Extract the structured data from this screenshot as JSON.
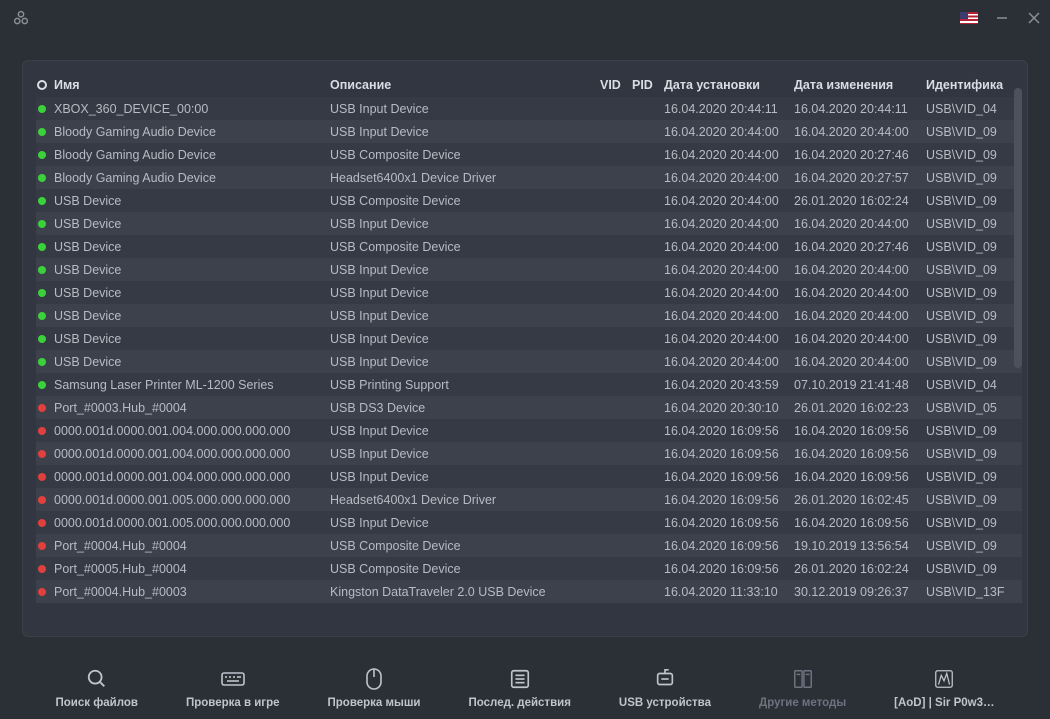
{
  "columns": {
    "name": "Имя",
    "desc": "Описание",
    "vid": "VID",
    "pid": "PID",
    "installed": "Дата установки",
    "modified": "Дата изменения",
    "id": "Идентифика"
  },
  "rows": [
    {
      "s": "green",
      "name": "XBOX_360_DEVICE_00:00",
      "desc": "USB Input Device",
      "vid": "",
      "pid": "",
      "inst": "16.04.2020 20:44:11",
      "mod": "16.04.2020 20:44:11",
      "id": "USB\\VID_04"
    },
    {
      "s": "green",
      "name": "Bloody Gaming Audio Device",
      "desc": "USB Input Device",
      "vid": "",
      "pid": "",
      "inst": "16.04.2020 20:44:00",
      "mod": "16.04.2020 20:44:00",
      "id": "USB\\VID_09"
    },
    {
      "s": "green",
      "name": "Bloody Gaming Audio Device",
      "desc": "USB Composite Device",
      "vid": "",
      "pid": "",
      "inst": "16.04.2020 20:44:00",
      "mod": "16.04.2020 20:27:46",
      "id": "USB\\VID_09"
    },
    {
      "s": "green",
      "name": "Bloody Gaming Audio Device",
      "desc": "Headset6400x1 Device Driver",
      "vid": "",
      "pid": "",
      "inst": "16.04.2020 20:44:00",
      "mod": "16.04.2020 20:27:57",
      "id": "USB\\VID_09"
    },
    {
      "s": "green",
      "name": "USB Device",
      "desc": "USB Composite Device",
      "vid": "",
      "pid": "",
      "inst": "16.04.2020 20:44:00",
      "mod": "26.01.2020 16:02:24",
      "id": "USB\\VID_09"
    },
    {
      "s": "green",
      "name": "USB Device",
      "desc": "USB Input Device",
      "vid": "",
      "pid": "",
      "inst": "16.04.2020 20:44:00",
      "mod": "16.04.2020 20:44:00",
      "id": "USB\\VID_09"
    },
    {
      "s": "green",
      "name": "USB Device",
      "desc": "USB Composite Device",
      "vid": "",
      "pid": "",
      "inst": "16.04.2020 20:44:00",
      "mod": "16.04.2020 20:27:46",
      "id": "USB\\VID_09"
    },
    {
      "s": "green",
      "name": "USB Device",
      "desc": "USB Input Device",
      "vid": "",
      "pid": "",
      "inst": "16.04.2020 20:44:00",
      "mod": "16.04.2020 20:44:00",
      "id": "USB\\VID_09"
    },
    {
      "s": "green",
      "name": "USB Device",
      "desc": "USB Input Device",
      "vid": "",
      "pid": "",
      "inst": "16.04.2020 20:44:00",
      "mod": "16.04.2020 20:44:00",
      "id": "USB\\VID_09"
    },
    {
      "s": "green",
      "name": "USB Device",
      "desc": "USB Input Device",
      "vid": "",
      "pid": "",
      "inst": "16.04.2020 20:44:00",
      "mod": "16.04.2020 20:44:00",
      "id": "USB\\VID_09"
    },
    {
      "s": "green",
      "name": "USB Device",
      "desc": "USB Input Device",
      "vid": "",
      "pid": "",
      "inst": "16.04.2020 20:44:00",
      "mod": "16.04.2020 20:44:00",
      "id": "USB\\VID_09"
    },
    {
      "s": "green",
      "name": "USB Device",
      "desc": "USB Input Device",
      "vid": "",
      "pid": "",
      "inst": "16.04.2020 20:44:00",
      "mod": "16.04.2020 20:44:00",
      "id": "USB\\VID_09"
    },
    {
      "s": "green",
      "name": "Samsung Laser Printer ML-1200 Series",
      "desc": "USB Printing Support",
      "vid": "",
      "pid": "",
      "inst": "16.04.2020 20:43:59",
      "mod": "07.10.2019 21:41:48",
      "id": "USB\\VID_04"
    },
    {
      "s": "red",
      "name": "Port_#0003.Hub_#0004",
      "desc": "USB DS3 Device",
      "vid": "",
      "pid": "",
      "inst": "16.04.2020 20:30:10",
      "mod": "26.01.2020 16:02:23",
      "id": "USB\\VID_05"
    },
    {
      "s": "red",
      "name": "0000.001d.0000.001.004.000.000.000.000",
      "desc": "USB Input Device",
      "vid": "",
      "pid": "",
      "inst": "16.04.2020 16:09:56",
      "mod": "16.04.2020 16:09:56",
      "id": "USB\\VID_09"
    },
    {
      "s": "red",
      "name": "0000.001d.0000.001.004.000.000.000.000",
      "desc": "USB Input Device",
      "vid": "",
      "pid": "",
      "inst": "16.04.2020 16:09:56",
      "mod": "16.04.2020 16:09:56",
      "id": "USB\\VID_09"
    },
    {
      "s": "red",
      "name": "0000.001d.0000.001.004.000.000.000.000",
      "desc": "USB Input Device",
      "vid": "",
      "pid": "",
      "inst": "16.04.2020 16:09:56",
      "mod": "16.04.2020 16:09:56",
      "id": "USB\\VID_09"
    },
    {
      "s": "red",
      "name": "0000.001d.0000.001.005.000.000.000.000",
      "desc": "Headset6400x1 Device Driver",
      "vid": "",
      "pid": "",
      "inst": "16.04.2020 16:09:56",
      "mod": "26.01.2020 16:02:45",
      "id": "USB\\VID_09"
    },
    {
      "s": "red",
      "name": "0000.001d.0000.001.005.000.000.000.000",
      "desc": "USB Input Device",
      "vid": "",
      "pid": "",
      "inst": "16.04.2020 16:09:56",
      "mod": "16.04.2020 16:09:56",
      "id": "USB\\VID_09"
    },
    {
      "s": "red",
      "name": "Port_#0004.Hub_#0004",
      "desc": "USB Composite Device",
      "vid": "",
      "pid": "",
      "inst": "16.04.2020 16:09:56",
      "mod": "19.10.2019 13:56:54",
      "id": "USB\\VID_09"
    },
    {
      "s": "red",
      "name": "Port_#0005.Hub_#0004",
      "desc": "USB Composite Device",
      "vid": "",
      "pid": "",
      "inst": "16.04.2020 16:09:56",
      "mod": "26.01.2020 16:02:24",
      "id": "USB\\VID_09"
    },
    {
      "s": "red",
      "name": "Port_#0004.Hub_#0003",
      "desc": "Kingston DataTraveler 2.0 USB Device",
      "vid": "",
      "pid": "",
      "inst": "16.04.2020 11:33:10",
      "mod": "30.12.2019 09:26:37",
      "id": "USB\\VID_13F"
    }
  ],
  "nav": {
    "search": "Поиск файлов",
    "ingame": "Проверка в игре",
    "mouse": "Проверка мыши",
    "recent": "Послед. действия",
    "usb": "USB устройства",
    "other": "Другие методы",
    "user": "[AoD] | Sir P0w3…"
  }
}
